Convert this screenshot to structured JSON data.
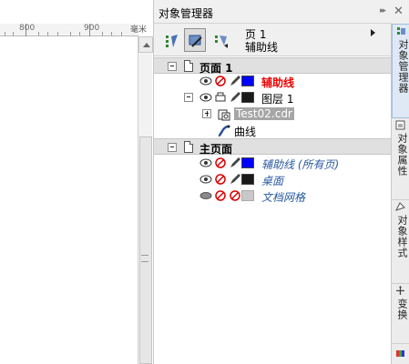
{
  "ruler": {
    "labels": [
      "800",
      "900"
    ],
    "unit": "毫米"
  },
  "docker": {
    "title": "对象管理器",
    "page_selector": {
      "page": "页 1",
      "layer": "辅助线"
    },
    "tree": {
      "page1": {
        "label": "页面 1",
        "guides_layer": "辅助线",
        "layer1": "图层 1",
        "object": "Test02.cdr",
        "curve": "曲线"
      },
      "master": {
        "label": "主页面",
        "guides_all": "辅助线 (所有页)",
        "desktop": "桌面",
        "doc_grid": "文档网格"
      }
    }
  },
  "side_tabs": [
    "对象管理器",
    "对象属性",
    "对象样式",
    "变换"
  ],
  "colors": {
    "guides": "#0000ff",
    "layer": "#1a1a1a",
    "desktop": "#1a1a1a",
    "grid": "#c8c8c8",
    "red_label": "#ee0000"
  }
}
